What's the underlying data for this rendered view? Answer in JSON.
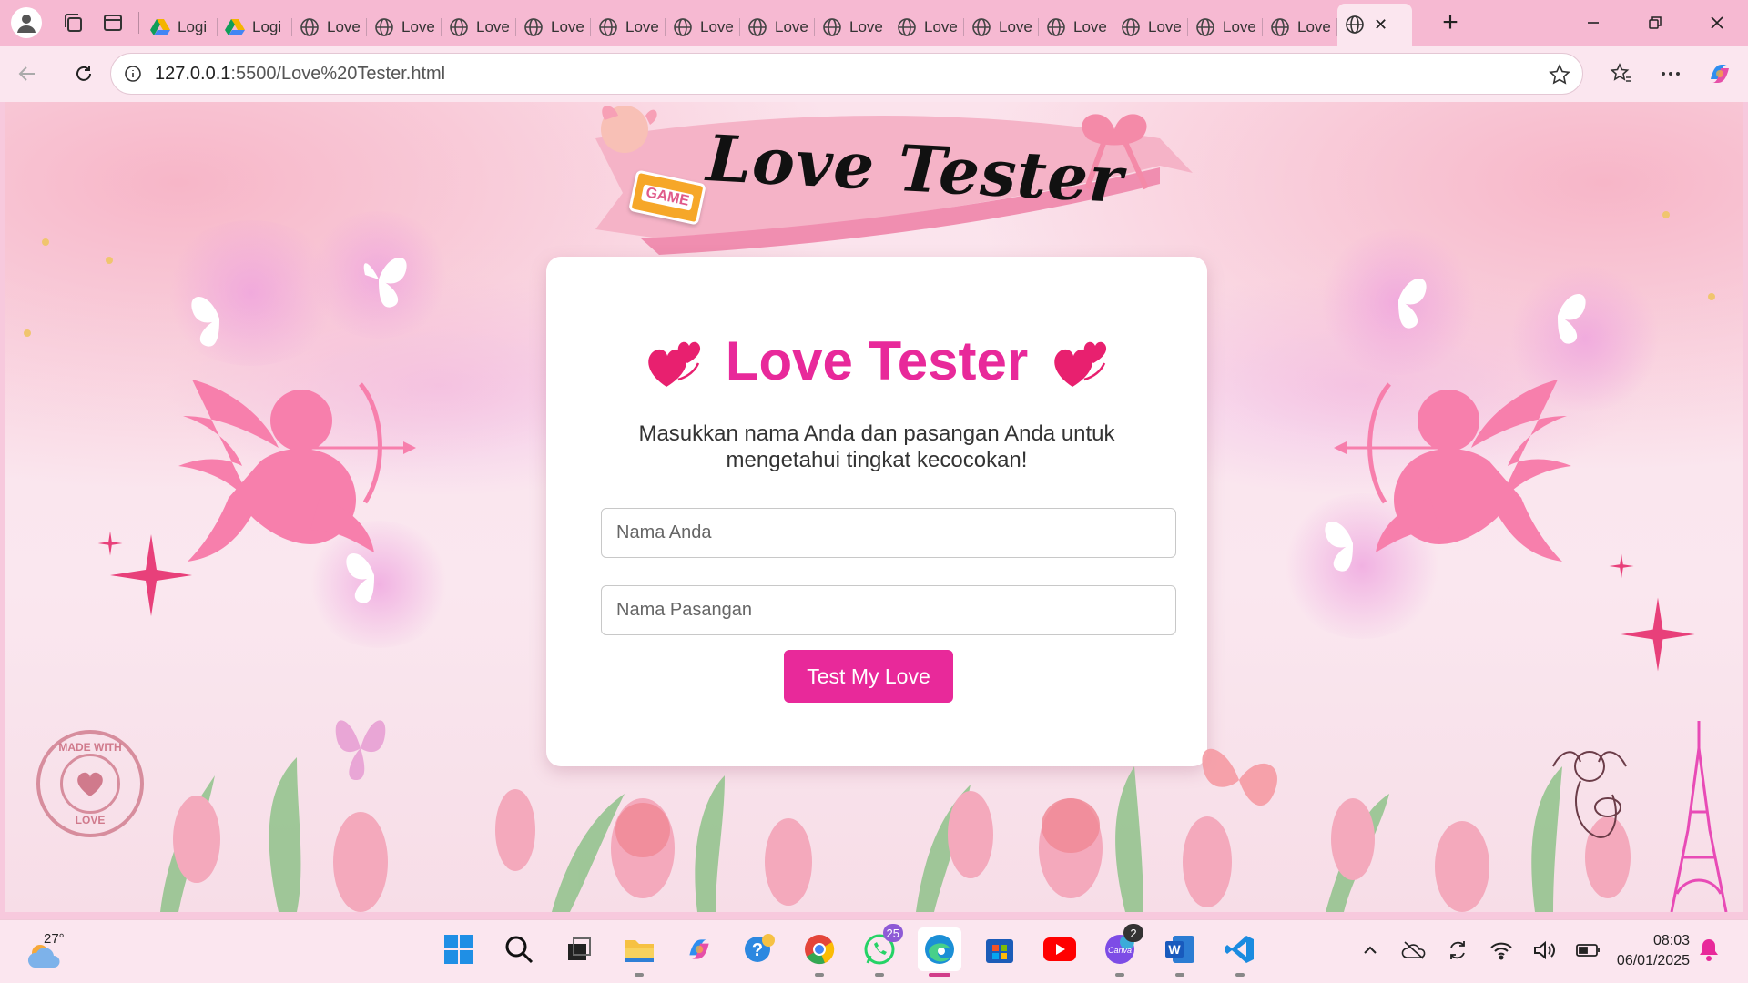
{
  "browser": {
    "tabs": [
      {
        "label": "Logi",
        "icon": "drive-icon"
      },
      {
        "label": "Logi",
        "icon": "drive-icon"
      },
      {
        "label": "Love",
        "icon": "globe-icon"
      },
      {
        "label": "Love",
        "icon": "globe-icon"
      },
      {
        "label": "Love",
        "icon": "globe-icon"
      },
      {
        "label": "Love",
        "icon": "globe-icon"
      },
      {
        "label": "Love",
        "icon": "globe-icon"
      },
      {
        "label": "Love",
        "icon": "globe-icon"
      },
      {
        "label": "Love",
        "icon": "globe-icon"
      },
      {
        "label": "Love",
        "icon": "globe-icon"
      },
      {
        "label": "Love",
        "icon": "globe-icon"
      },
      {
        "label": "Love",
        "icon": "globe-icon"
      },
      {
        "label": "Love",
        "icon": "globe-icon"
      },
      {
        "label": "Love",
        "icon": "globe-icon"
      },
      {
        "label": "Love",
        "icon": "globe-icon"
      },
      {
        "label": "Love",
        "icon": "globe-icon"
      }
    ],
    "active_tab_close": "✕",
    "new_tab": "+",
    "url_host": "127.0.0.1",
    "url_path": ":5500/Love%20Tester.html"
  },
  "page": {
    "banner_title": "Love Tester",
    "game_tag": "GAME",
    "heading": "Love Tester",
    "description": "Masukkan nama Anda dan pasangan Anda untuk mengetahui tingkat kecocokan!",
    "input_name_placeholder": "Nama Anda",
    "input_partner_placeholder": "Nama Pasangan",
    "button_label": "Test My Love",
    "stamp_text_top": "MADE WITH",
    "stamp_text_bottom": "LOVE",
    "colors": {
      "accent": "#e8299a",
      "background": "#fbe3ec"
    }
  },
  "taskbar": {
    "weather_temp": "27°",
    "whatsapp_badge": "25",
    "canva_badge": "2",
    "canva_label": "Canva",
    "time": "08:03",
    "date": "06/01/2025"
  }
}
